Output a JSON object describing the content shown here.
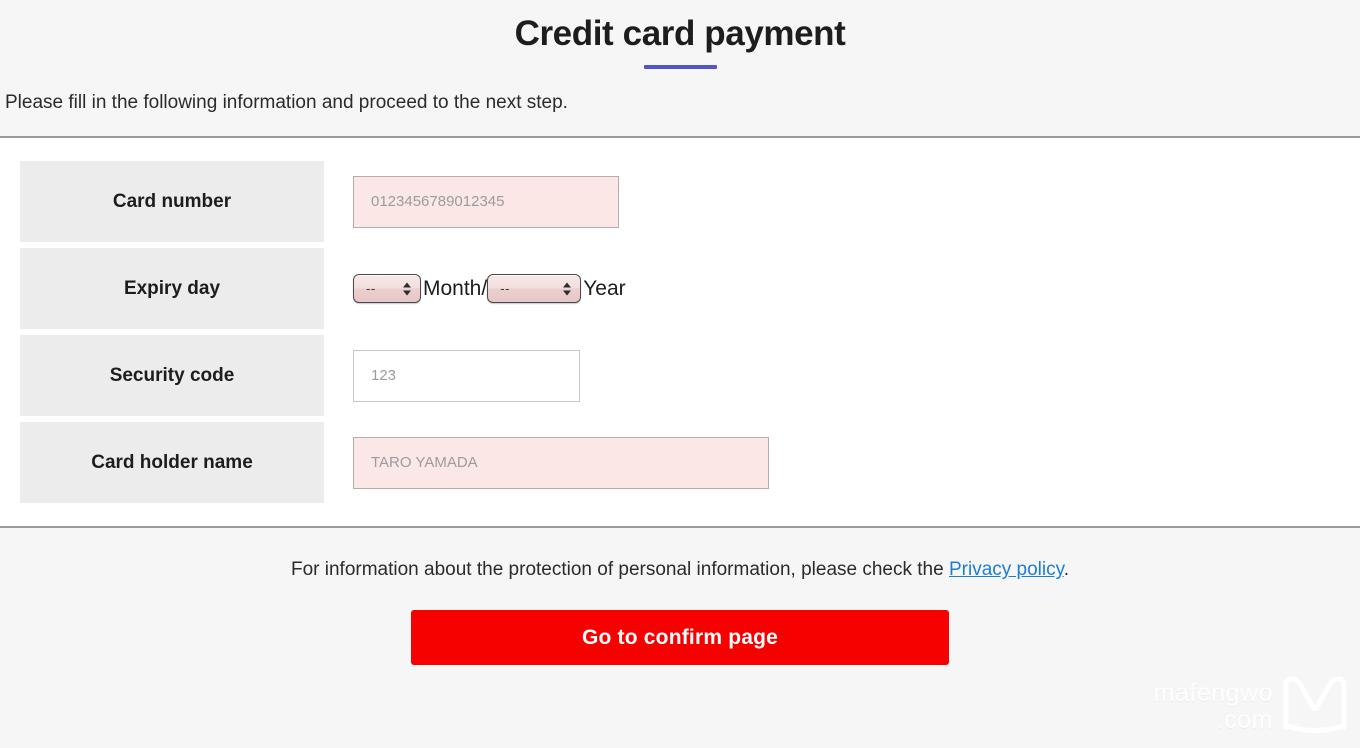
{
  "header": {
    "title": "Credit card payment",
    "accent_color": "#5055c8",
    "intro": "Please fill in the following information and proceed to the next step."
  },
  "form": {
    "rows": [
      {
        "label": "Card number",
        "field_type": "text",
        "placeholder": "0123456789012345",
        "value": "",
        "highlighted": true
      },
      {
        "label": "Expiry day",
        "field_type": "expiry",
        "month_value": "--",
        "month_suffix": "Month/",
        "year_value": "--",
        "year_suffix": "Year"
      },
      {
        "label": "Security code",
        "field_type": "text",
        "placeholder": "123",
        "value": "",
        "highlighted": false
      },
      {
        "label": "Card holder name",
        "field_type": "text",
        "placeholder": "TARO YAMADA",
        "value": "",
        "highlighted": true
      }
    ]
  },
  "footer": {
    "privacy_prefix": "For information about the protection of personal information, please check the ",
    "privacy_link": "Privacy policy",
    "privacy_suffix": ".",
    "submit_label": "Go to confirm page",
    "submit_color": "#f60000"
  },
  "watermark": {
    "line1": "mafengwo",
    "line2": ".com",
    "logo": "mafengwo-m-logo-icon"
  }
}
